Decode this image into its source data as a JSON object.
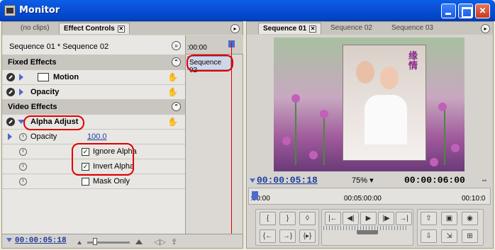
{
  "window": {
    "title": "Monitor"
  },
  "left_panel": {
    "tabs": [
      {
        "label": "(no clips)"
      },
      {
        "label": "Effect Controls"
      }
    ],
    "breadcrumb": "Sequence 01 * Sequence 02",
    "fixed_effects_label": "Fixed Effects",
    "motion_label": "Motion",
    "opacity_label": "Opacity",
    "video_effects_label": "Video Effects",
    "alpha_adjust_label": "Alpha Adjust",
    "param_opacity_label": "Opacity",
    "param_opacity_value": "100.0",
    "ignore_alpha_label": "Ignore Alpha",
    "invert_alpha_label": "Invert Alpha",
    "mask_only_label": "Mask Only",
    "mini_timeline_time": ":00:00",
    "mini_clip_label": "Sequence 02",
    "current_time": "00:00:05:18",
    "checkbox_checked_glyph": "✓"
  },
  "right_panel": {
    "tabs": [
      {
        "label": "Sequence 01"
      },
      {
        "label": "Sequence 02"
      },
      {
        "label": "Sequence 03"
      }
    ],
    "video_chars": "缘情",
    "current_time": "00:00:05:18",
    "zoom_label": "75%",
    "duration": "00:00:06:00",
    "ruler_labels": [
      ":00:00",
      "00:05:00:00",
      "00:10:0"
    ]
  },
  "colors": {
    "titlebar": "#0046c8",
    "highlight_ring": "#e00000",
    "timecode_blue": "#1d3c9c"
  }
}
